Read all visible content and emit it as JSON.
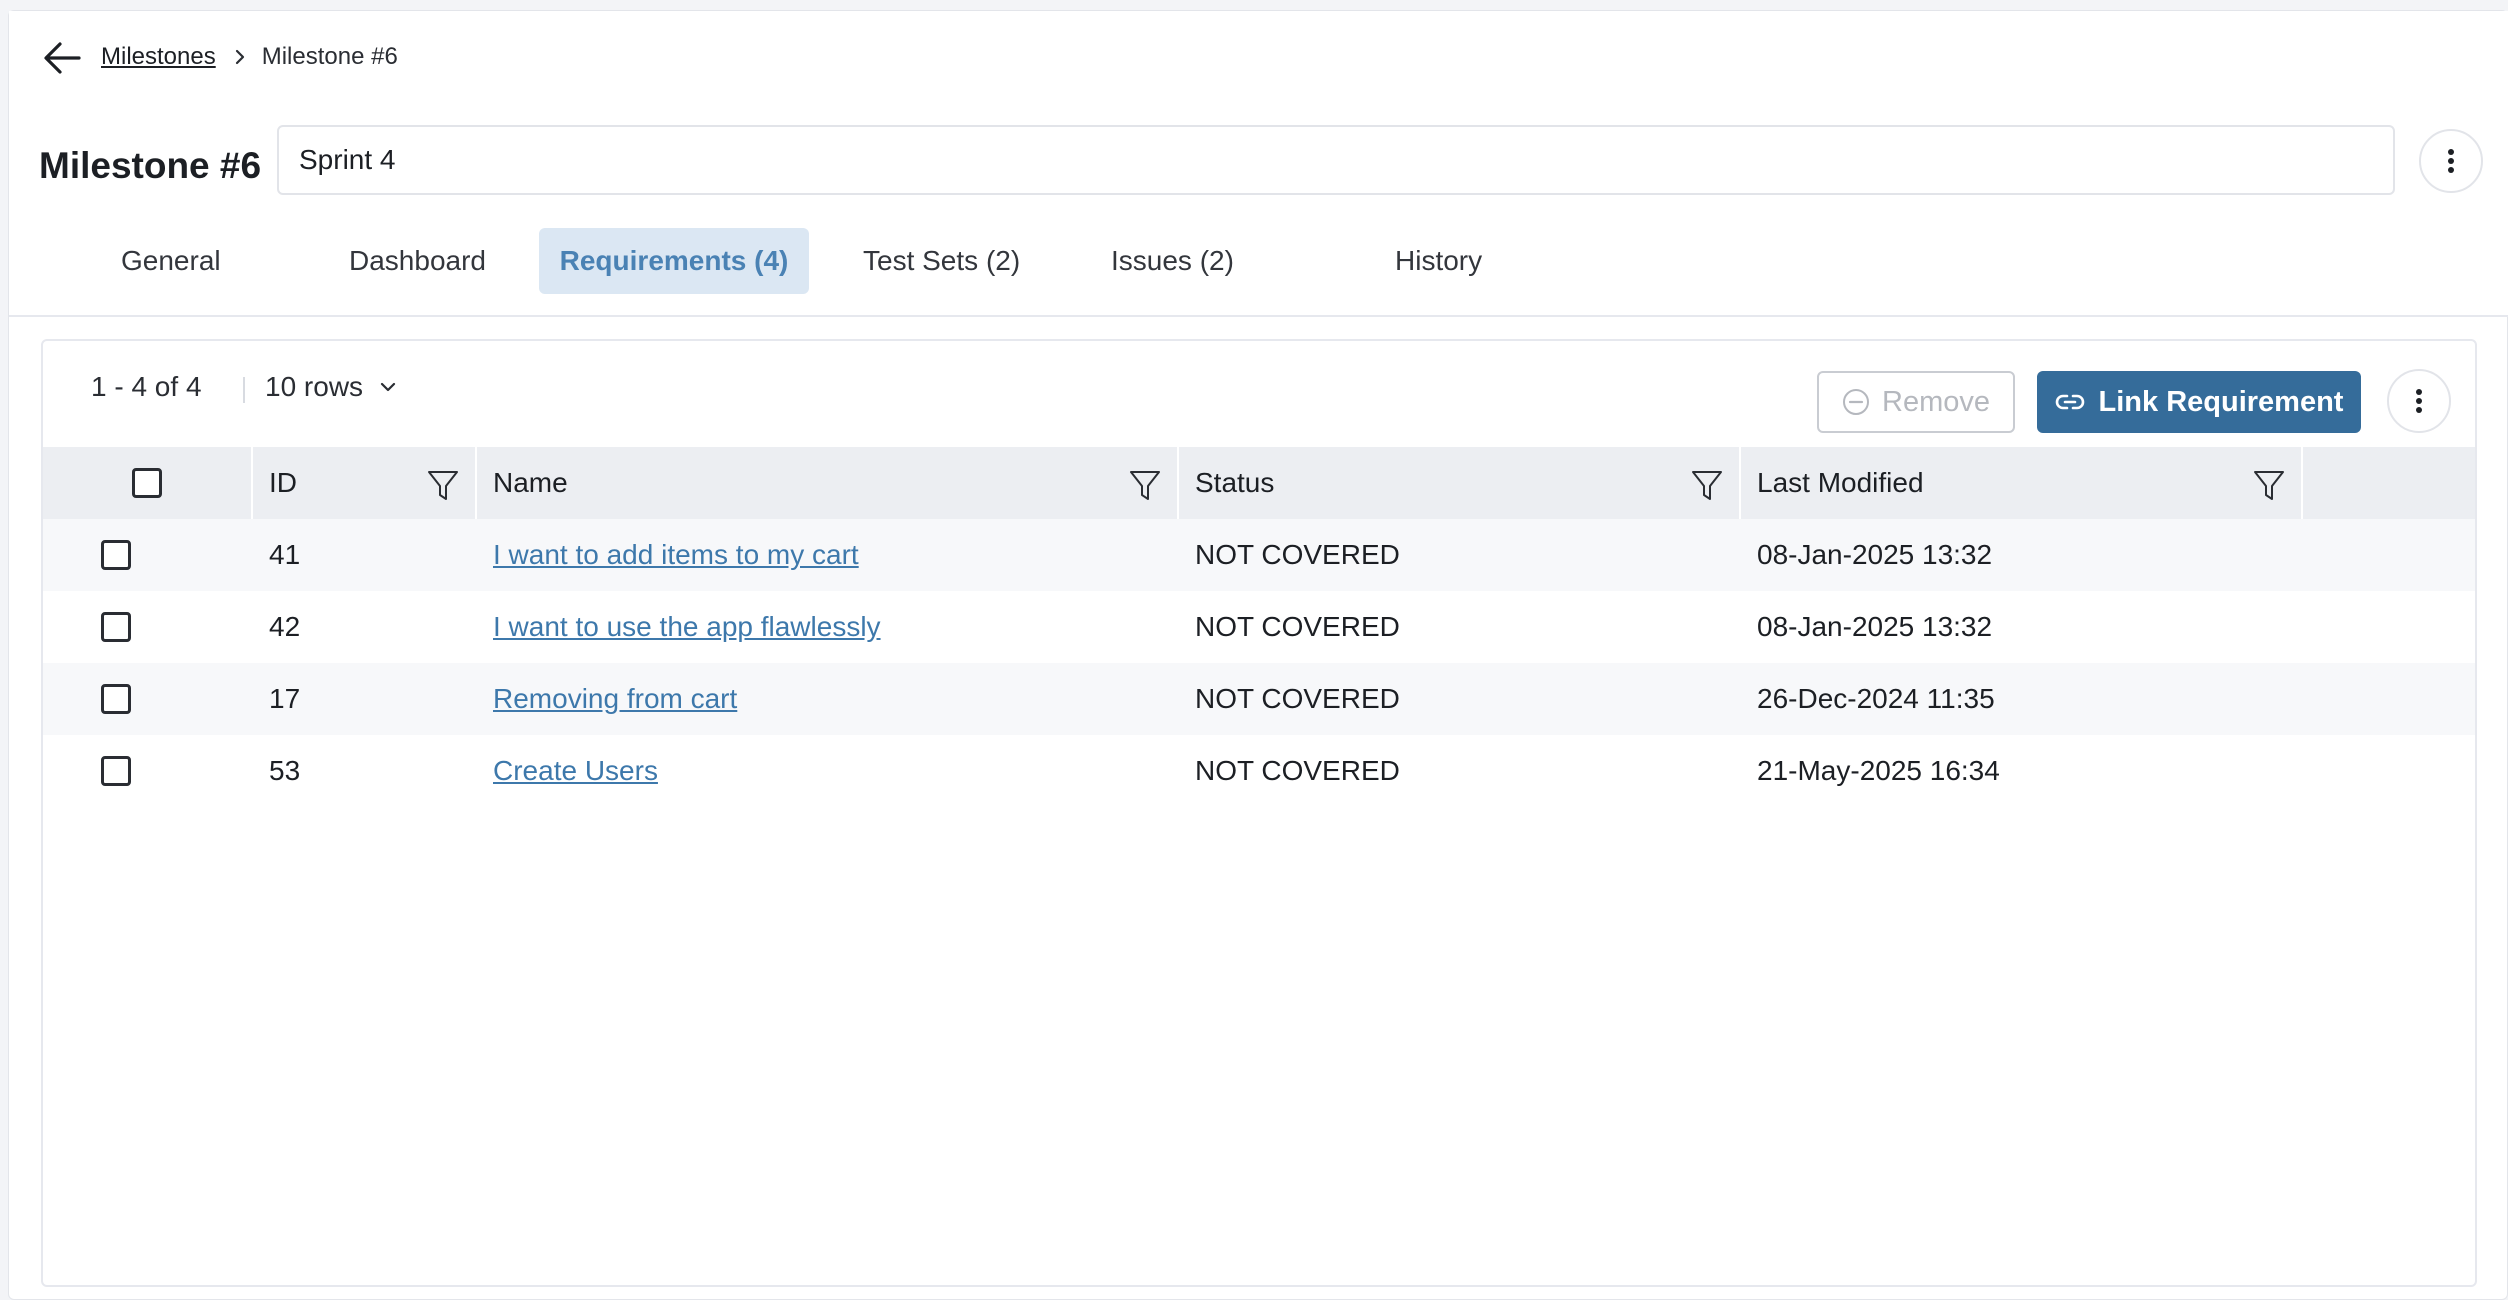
{
  "breadcrumb": {
    "parent": "Milestones",
    "current": "Milestone #6"
  },
  "header": {
    "title": "Milestone #6",
    "name_value": "Sprint 4"
  },
  "tabs": [
    {
      "label": "General"
    },
    {
      "label": "Dashboard"
    },
    {
      "label": "Requirements (4)"
    },
    {
      "label": "Test Sets (2)"
    },
    {
      "label": "Issues (2)"
    },
    {
      "label": "History"
    }
  ],
  "active_tab": "Requirements (4)",
  "toolbar": {
    "pagination": "1 - 4 of 4",
    "rows_per_page": "10 rows",
    "remove_label": "Remove",
    "link_label": "Link Requirement"
  },
  "table": {
    "columns": {
      "id": "ID",
      "name": "Name",
      "status": "Status",
      "modified": "Last Modified"
    },
    "rows": [
      {
        "id": "41",
        "name": "I want to add items to my cart",
        "status": "NOT COVERED",
        "modified": "08-Jan-2025 13:32"
      },
      {
        "id": "42",
        "name": "I want to use the app flawlessly",
        "status": "NOT COVERED",
        "modified": "08-Jan-2025 13:32"
      },
      {
        "id": "17",
        "name": "Removing from cart",
        "status": "NOT COVERED",
        "modified": "26-Dec-2024 11:35"
      },
      {
        "id": "53",
        "name": "Create Users",
        "status": "NOT COVERED",
        "modified": "21-May-2025 16:34"
      }
    ]
  },
  "colors": {
    "accent": "#356c9a",
    "active_tab_bg": "#dbe7f3",
    "link": "#3d78ab"
  }
}
